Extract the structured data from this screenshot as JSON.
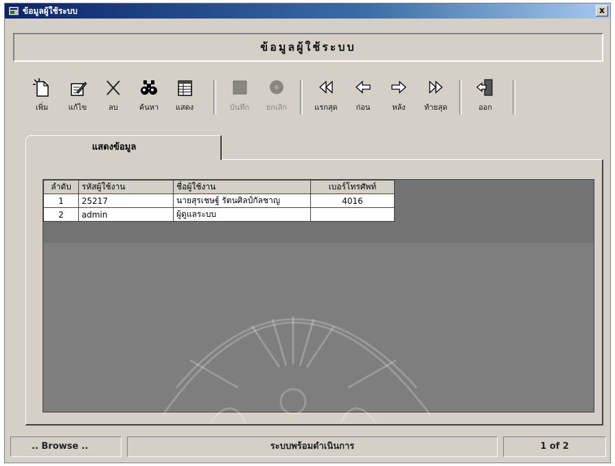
{
  "window": {
    "title": "ข้อมูลผู้ใช้ระบบ",
    "close_label": "x"
  },
  "heading": "ข้อมูลผู้ใช้ระบบ",
  "toolbar": {
    "add": "เพิ่ม",
    "edit": "แก้ไข",
    "delete": "ลบ",
    "search": "ค้นหา",
    "show": "แสดง",
    "save": "บันทึก",
    "cancel": "ยกเลิก",
    "first": "แรกสุด",
    "prev": "ก่อน",
    "next": "หลัง",
    "last": "ท้ายสุด",
    "exit": "ออก"
  },
  "tab": {
    "label": "แสดงข้อมูล"
  },
  "table": {
    "headers": [
      "ลำดับ",
      "รหัสผู้ใช้งาน",
      "ชื่อผู้ใช้งาน",
      "เบอร์โทรศัพท์"
    ],
    "rows": [
      [
        "1",
        "25217",
        "นายสุรเชษฐ์ รัตนศิลป์กัลชาญ",
        "4016"
      ],
      [
        "2",
        "admin",
        "ผู้ดูแลระบบ",
        ""
      ]
    ]
  },
  "status": {
    "mode": ".. Browse ..",
    "message": "ระบบพร้อมดำเนินการ",
    "record": "1 of 2"
  }
}
